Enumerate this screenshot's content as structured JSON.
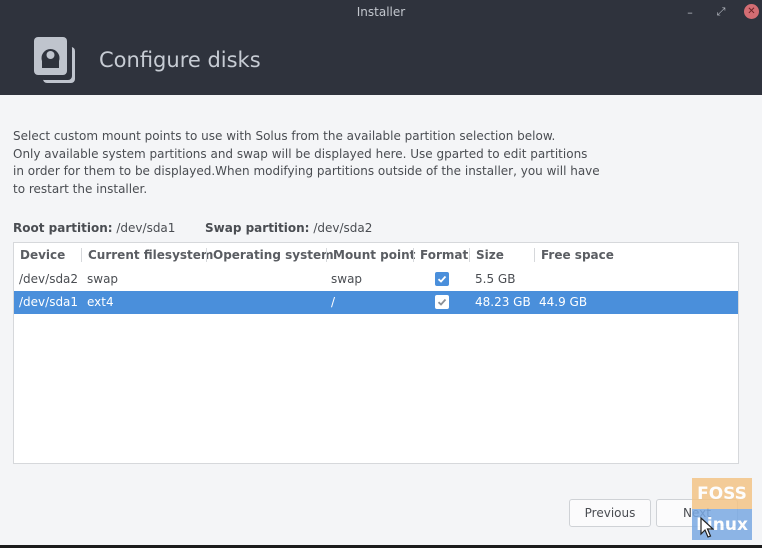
{
  "window": {
    "title": "Installer",
    "minimize_glyph": "–",
    "maximize_glyph": "⤢",
    "close_glyph": "✕"
  },
  "header": {
    "icon": "disks-icon",
    "title": "Configure disks"
  },
  "description": [
    "Select custom mount points to use with Solus from the available partition selection below.",
    "Only available system partitions and swap will be displayed here. Use gparted to edit partitions",
    "in order for them to be displayed.When modifying partitions outside of the installer, you will have",
    "to restart the installer."
  ],
  "partitions": {
    "root_label": "Root partition:",
    "root_value": "/dev/sda1",
    "swap_label": "Swap partition:",
    "swap_value": "/dev/sda2"
  },
  "table": {
    "columns": [
      "Device",
      "Current filesystem",
      "Operating system",
      "Mount point",
      "Format",
      "Size",
      "Free space"
    ],
    "rows": [
      {
        "device": "/dev/sda2",
        "filesystem": "swap",
        "os": "",
        "mount": "swap",
        "format": true,
        "size": "5.5 GB",
        "free": "",
        "selected": false
      },
      {
        "device": "/dev/sda1",
        "filesystem": "ext4",
        "os": "",
        "mount": "/",
        "format": true,
        "size": "48.23 GB",
        "free": "44.9 GB",
        "selected": true
      }
    ]
  },
  "buttons": {
    "previous": "Previous",
    "next": "Next"
  },
  "watermark": {
    "top": "FOSS",
    "bottom": "Linux"
  },
  "colors": {
    "accent": "#4a8fdb",
    "titlebar": "#2f333d",
    "close": "#d36d73"
  }
}
